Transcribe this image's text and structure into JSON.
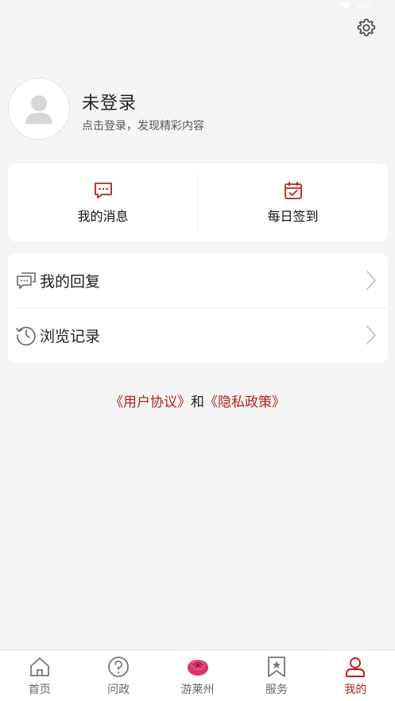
{
  "status_bar": {
    "time": "4:09"
  },
  "profile": {
    "name": "未登录",
    "subtitle": "点击登录，发现精彩内容"
  },
  "quick_actions": [
    {
      "label": "我的消息",
      "icon": "message-icon"
    },
    {
      "label": "每日签到",
      "icon": "calendar-check-icon"
    }
  ],
  "list": [
    {
      "label": "我的回复",
      "icon": "chat-bubbles-icon"
    },
    {
      "label": "浏览记录",
      "icon": "history-icon"
    }
  ],
  "agreement": {
    "user_agreement": "《用户协议》",
    "and": "和",
    "privacy_policy": "《隐私政策》"
  },
  "tabs": [
    {
      "label": "首页",
      "icon": "home-icon",
      "active": false
    },
    {
      "label": "问政",
      "icon": "question-icon",
      "active": false
    },
    {
      "label": "游莱州",
      "icon": "rose-icon",
      "active": false
    },
    {
      "label": "服务",
      "icon": "bookmark-star-icon",
      "active": false
    },
    {
      "label": "我的",
      "icon": "user-icon",
      "active": true
    }
  ],
  "colors": {
    "accent": "#b3241a",
    "background": "#f5f5f5",
    "card": "#ffffff"
  }
}
